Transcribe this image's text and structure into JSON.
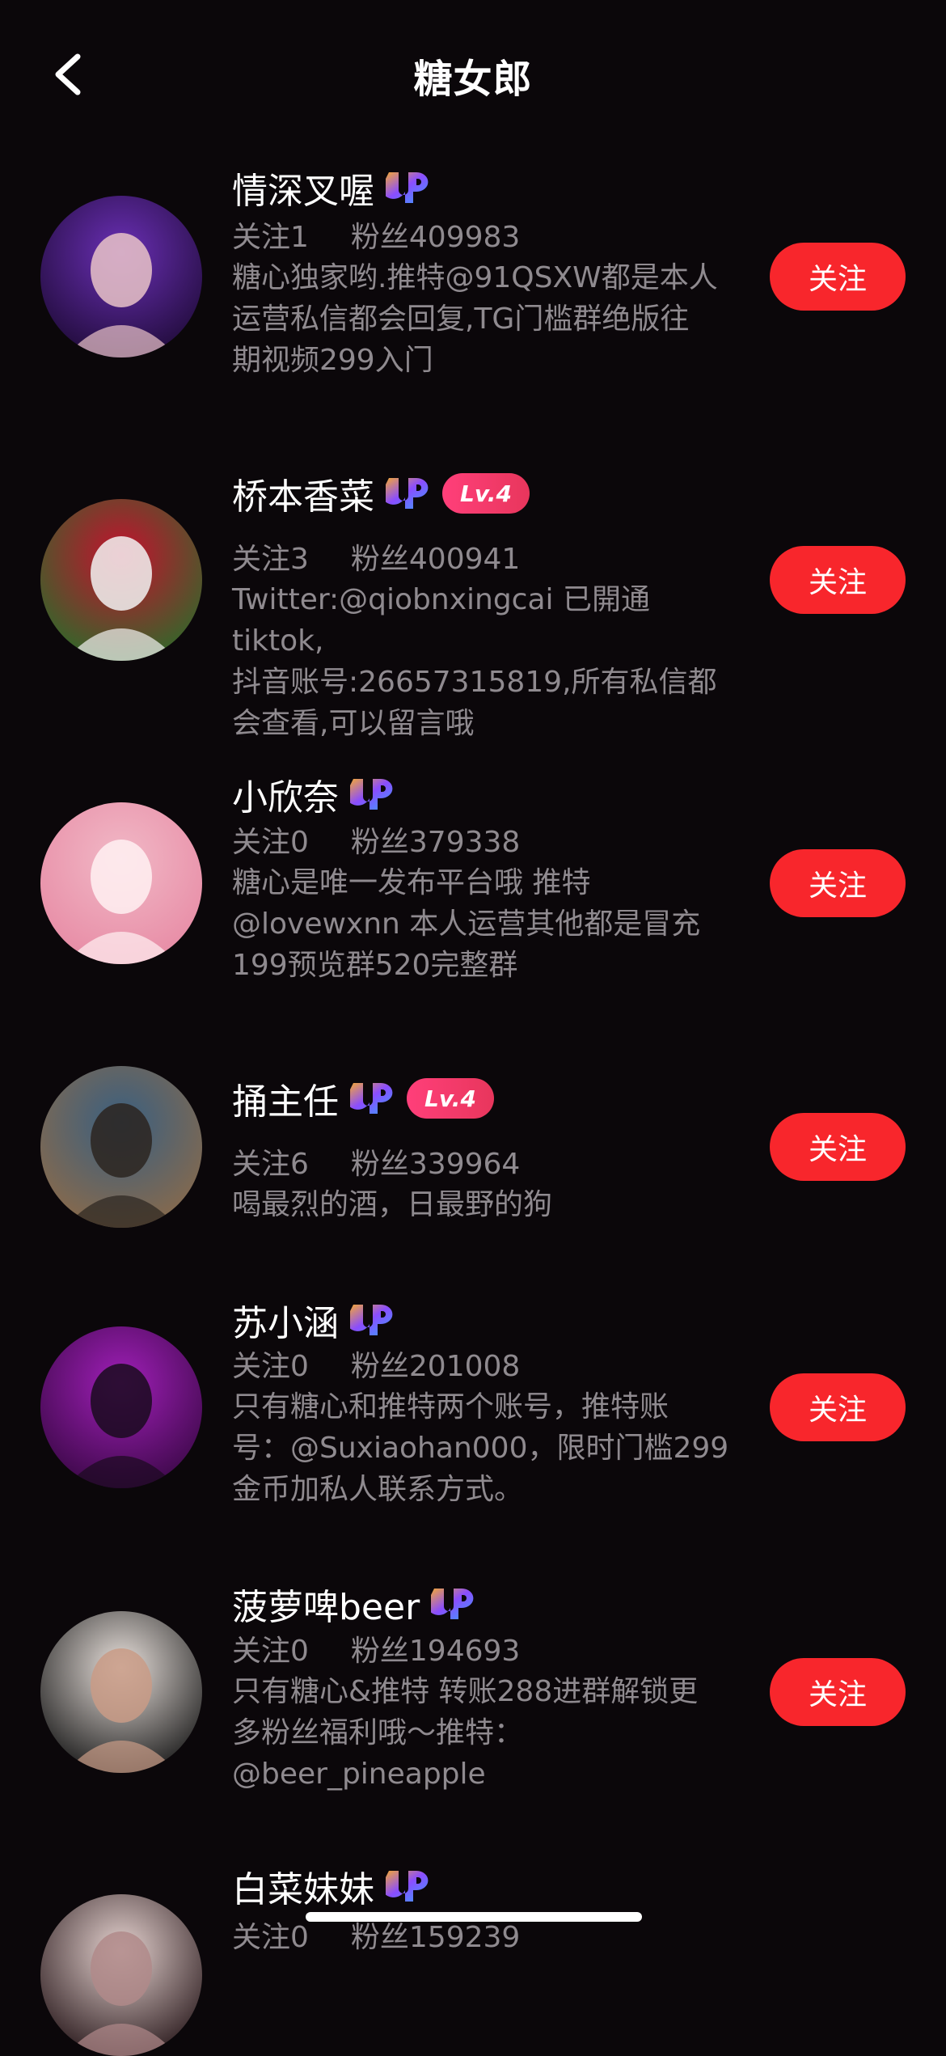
{
  "header": {
    "title": "糖女郎"
  },
  "follow_label": "关注",
  "users": [
    {
      "name": "情深叉喔",
      "lv": "",
      "following": "关注1",
      "fans": "粉丝409983",
      "bio": [
        "糖心独家哟.推特@91QSXW都是本人",
        "运营私信都会回复,TG门槛群绝版往",
        "期视频299入门"
      ],
      "avatar_colors": [
        "#6a2fb5",
        "#1f0b38",
        "#e9c3c8"
      ]
    },
    {
      "name": "桥本香菜",
      "lv": "Lv.4",
      "following": "关注3",
      "fans": "粉丝400941",
      "bio": [
        "Twitter:@qiobnxingcai 已開通tiktok,",
        "抖音账号:26657315819,所有私信都",
        "会查看,可以留言哦"
      ],
      "avatar_colors": [
        "#c4112e",
        "#2d6a2a",
        "#f2f2f2"
      ]
    },
    {
      "name": "小欣奈",
      "lv": "",
      "following": "关注0",
      "fans": "粉丝379338",
      "bio": [
        "糖心是唯一发布平台哦 推特",
        "@lovewxnn 本人运营其他都是冒充",
        "199预览群520完整群"
      ],
      "avatar_colors": [
        "#f1b8c6",
        "#e78aa4",
        "#fff1f2"
      ]
    },
    {
      "name": "捅主任",
      "lv": "Lv.4",
      "following": "关注6",
      "fans": "粉丝339964",
      "bio": [
        "喝最烈的酒，日最野的狗"
      ],
      "avatar_colors": [
        "#3a5f80",
        "#8a6a4a",
        "#2b2520"
      ]
    },
    {
      "name": "苏小涵",
      "lv": "",
      "following": "关注0",
      "fans": "粉丝201008",
      "bio": [
        "只有糖心和推特两个账号，推特账",
        "号：@Suxiaohan000，限时门槛299",
        "金币加私人联系方式。"
      ],
      "avatar_colors": [
        "#a01fb8",
        "#3a0846",
        "#1a0a1e"
      ]
    },
    {
      "name": "菠萝啤beer",
      "lv": "",
      "following": "关注0",
      "fans": "粉丝194693",
      "bio": [
        "只有糖心&推特 转账288进群解锁更",
        "多粉丝福利哦～推特：",
        "@beer_pineapple"
      ],
      "avatar_colors": [
        "#e9e1dc",
        "#1a1a1a",
        "#c99b86"
      ]
    },
    {
      "name": "白菜妹妹",
      "lv": "",
      "following": "关注0",
      "fans": "粉丝159239",
      "bio": [],
      "avatar_colors": [
        "#e6d3d0",
        "#2a1a1d",
        "#b0898a"
      ]
    }
  ],
  "colors": {
    "background": "#0b070a",
    "accent": "#f8262c",
    "secondary_text": "#8f8a8f"
  }
}
